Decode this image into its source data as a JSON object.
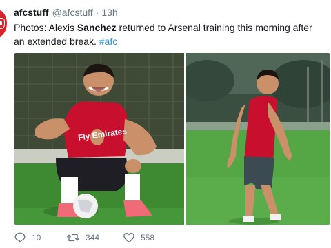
{
  "tweet": {
    "display_name": "afcstuff",
    "handle": "@afcstuff",
    "separator": "·",
    "time": "13h",
    "text_pre": "Photos: Alexis ",
    "text_bold": "Sanchez",
    "text_post": " returned to Arsenal training this morning after an extended break. ",
    "hashtag": "#afc"
  },
  "photos": {
    "photo1": {
      "shirt_text": "Fly Emirates"
    }
  },
  "actions": {
    "reply_count": "10",
    "retweet_count": "344",
    "like_count": "558"
  },
  "colors": {
    "accent": "#1b95e0",
    "text": "#14171a",
    "muted": "#657786",
    "arsenal_red": "#d9222a"
  },
  "icons": [
    "reply-icon",
    "retweet-icon",
    "heart-icon",
    "arsenal-crest-icon"
  ]
}
